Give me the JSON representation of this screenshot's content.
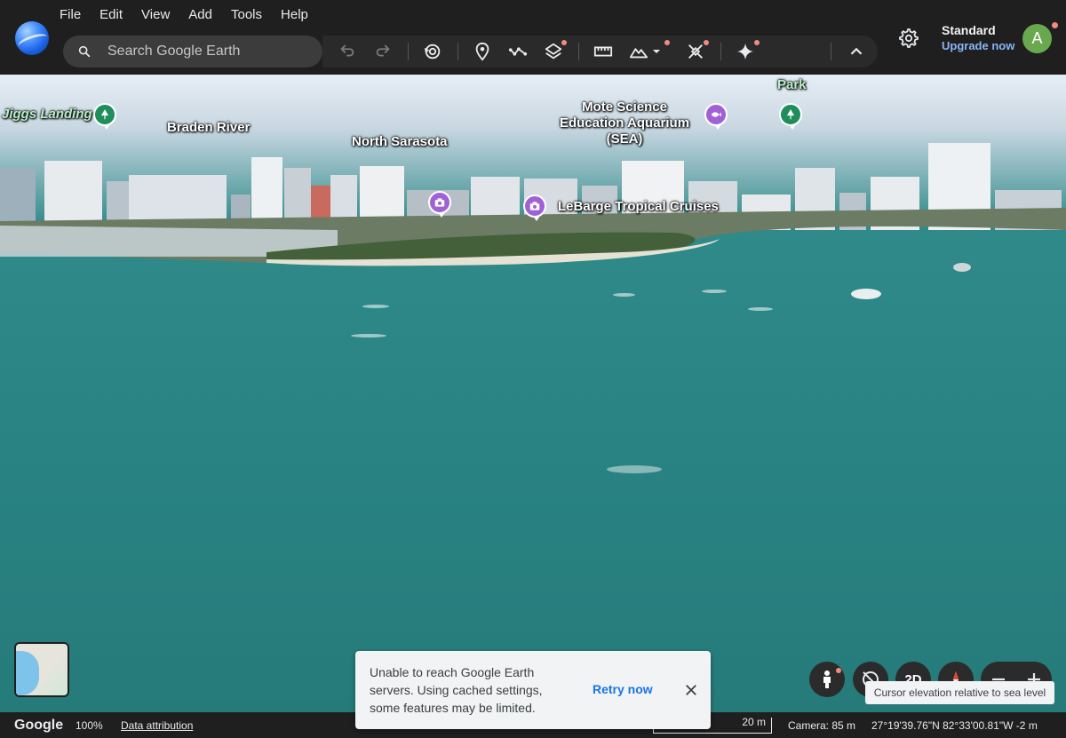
{
  "menu": [
    "File",
    "Edit",
    "View",
    "Add",
    "Tools",
    "Help"
  ],
  "search": {
    "placeholder": "Search Google Earth"
  },
  "account": {
    "plan": "Standard",
    "upgrade_label": "Upgrade now",
    "avatar_initial": "A"
  },
  "map_labels": {
    "jiggs_landing": "Jiggs Landing",
    "braden_river": "Braden River",
    "north_sarasota": "North Sarasota",
    "mote_aquarium": "Mote Science Education Aquarium (SEA)",
    "park": "Park",
    "lebarge": "LeBarge Tropical Cruises"
  },
  "toast": {
    "message": "Unable to reach Google Earth servers. Using cached settings, some features may be limited.",
    "retry_label": "Retry now"
  },
  "controls": {
    "view_mode_label": "2D",
    "tooltip": "Cursor elevation relative to sea level"
  },
  "status": {
    "logo": "Google",
    "zoom": "100%",
    "attribution": "Data attribution",
    "scale": "20 m",
    "camera": "Camera: 85 m",
    "coords": "27°19'39.76\"N 82°33'00.81\"W  -2 m"
  },
  "colors": {
    "accent": "#8ab4f8",
    "water": "#2a8584",
    "toolbar": "#2a2a2a",
    "notification_dot": "#f28b82"
  }
}
